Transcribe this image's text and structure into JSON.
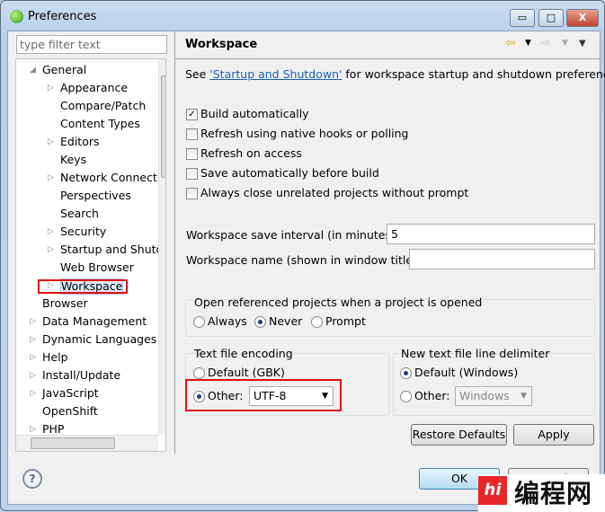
{
  "window": {
    "title": "Preferences",
    "minimize": "▭",
    "maximize": "□",
    "close": "X"
  },
  "filter": {
    "placeholder": "type filter text"
  },
  "tree": [
    {
      "label": "General",
      "level": 0,
      "state": "expanded"
    },
    {
      "label": "Appearance",
      "level": 1,
      "state": "collapsed"
    },
    {
      "label": "Compare/Patch",
      "level": 1,
      "state": "leaf"
    },
    {
      "label": "Content Types",
      "level": 1,
      "state": "leaf"
    },
    {
      "label": "Editors",
      "level": 1,
      "state": "collapsed"
    },
    {
      "label": "Keys",
      "level": 1,
      "state": "leaf"
    },
    {
      "label": "Network Connections",
      "level": 1,
      "state": "collapsed"
    },
    {
      "label": "Perspectives",
      "level": 1,
      "state": "leaf"
    },
    {
      "label": "Search",
      "level": 1,
      "state": "leaf"
    },
    {
      "label": "Security",
      "level": 1,
      "state": "collapsed"
    },
    {
      "label": "Startup and Shutdown",
      "level": 1,
      "state": "collapsed"
    },
    {
      "label": "Web Browser",
      "level": 1,
      "state": "leaf"
    },
    {
      "label": "Workspace",
      "level": 1,
      "state": "collapsed",
      "selected": true
    },
    {
      "label": "Browser",
      "level": 0,
      "state": "leaf"
    },
    {
      "label": "Data Management",
      "level": 0,
      "state": "collapsed"
    },
    {
      "label": "Dynamic Languages",
      "level": 0,
      "state": "collapsed"
    },
    {
      "label": "Help",
      "level": 0,
      "state": "collapsed"
    },
    {
      "label": "Install/Update",
      "level": 0,
      "state": "collapsed"
    },
    {
      "label": "JavaScript",
      "level": 0,
      "state": "collapsed"
    },
    {
      "label": "OpenShift",
      "level": 0,
      "state": "leaf"
    },
    {
      "label": "PHP",
      "level": 0,
      "state": "collapsed"
    }
  ],
  "page": {
    "title": "Workspace",
    "intro_pre": "See ",
    "intro_link": "'Startup and Shutdown'",
    "intro_post": " for workspace startup and shutdown preferences.",
    "checkboxes": [
      {
        "label": "Build automatically",
        "checked": true
      },
      {
        "label": "Refresh using native hooks or polling",
        "checked": false
      },
      {
        "label": "Refresh on access",
        "checked": false
      },
      {
        "label": "Save automatically before build",
        "checked": false
      },
      {
        "label": "Always close unrelated projects without prompt",
        "checked": false
      }
    ],
    "save_interval_label": "Workspace save interval (in minutes):",
    "save_interval_value": "5",
    "ws_name_label": "Workspace name (shown in window title):",
    "ws_name_value": "",
    "open_ref": {
      "label": "Open referenced projects when a project is opened",
      "options": [
        "Always",
        "Never",
        "Prompt"
      ],
      "selected": "Never"
    },
    "encoding": {
      "label": "Text file encoding",
      "default": "Default (GBK)",
      "other": "Other:",
      "value": "UTF-8",
      "selected": "Other"
    },
    "delimiter": {
      "label": "New text file line delimiter",
      "default": "Default (Windows)",
      "other": "Other:",
      "value": "Windows",
      "selected": "Default"
    },
    "restore": "Restore Defaults",
    "apply": "Apply"
  },
  "footer": {
    "ok": "OK",
    "cancel": "Cancel",
    "help": "?"
  },
  "watermark": "编程网",
  "colors": {
    "highlight": "#e01010",
    "link": "#1a5fb4"
  }
}
